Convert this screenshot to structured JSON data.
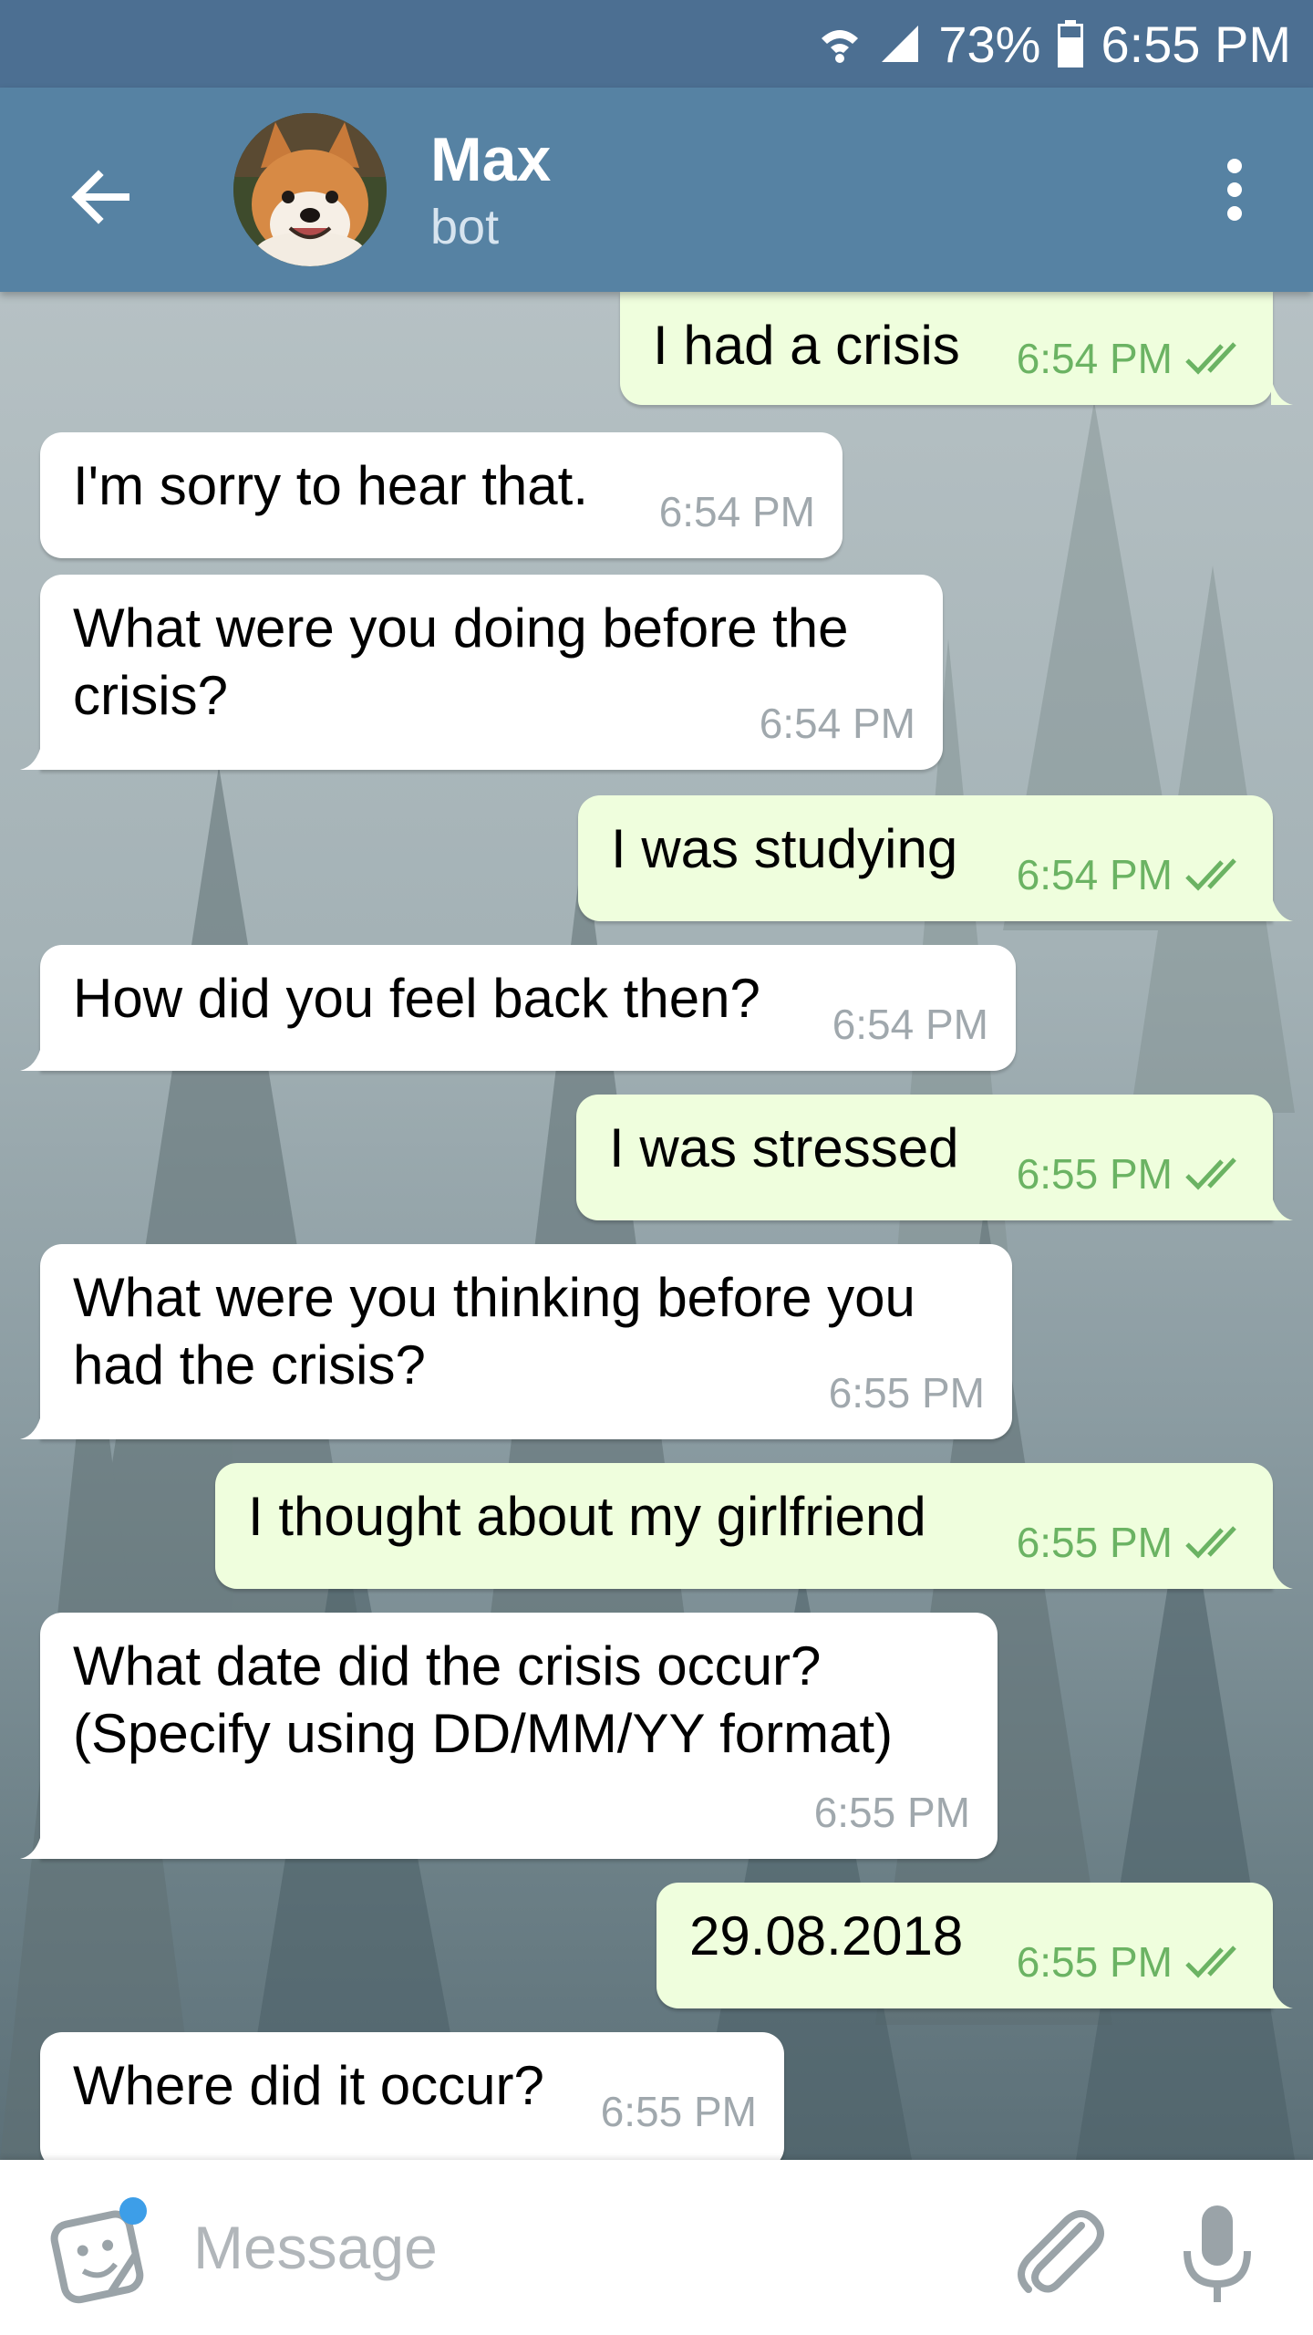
{
  "status_bar": {
    "battery": "73%",
    "time": "6:55 PM",
    "icons": [
      "wifi-icon",
      "signal-icon",
      "battery-icon"
    ]
  },
  "header": {
    "name": "Max",
    "status": "bot",
    "icons": [
      "back-arrow-icon",
      "avatar",
      "more-vert-icon"
    ]
  },
  "messages": [
    {
      "dir": "out",
      "text": "I had a crisis",
      "time": "6:54 PM"
    },
    {
      "dir": "in",
      "text": "I'm sorry to hear that.",
      "time": "6:54 PM"
    },
    {
      "dir": "in",
      "text": "What were you doing before the crisis?",
      "time": "6:54 PM"
    },
    {
      "dir": "out",
      "text": "I was studying",
      "time": "6:54 PM"
    },
    {
      "dir": "in",
      "text": "How did you feel back then?",
      "time": "6:54 PM"
    },
    {
      "dir": "out",
      "text": "I was stressed",
      "time": "6:55 PM"
    },
    {
      "dir": "in",
      "text": "What were you thinking before you had the crisis?",
      "time": "6:55 PM"
    },
    {
      "dir": "out",
      "text": "I thought about my girlfriend",
      "time": "6:55 PM"
    },
    {
      "dir": "in",
      "text": "What date did the crisis occur? (Specify using DD/MM/YY format)",
      "time": "6:55 PM"
    },
    {
      "dir": "out",
      "text": "29.08.2018",
      "time": "6:55 PM"
    },
    {
      "dir": "in",
      "text": "Where did it occur?",
      "time": "6:55 PM"
    }
  ],
  "composer": {
    "placeholder": "Message",
    "icons": [
      "sticker-icon",
      "paperclip-icon",
      "microphone-icon"
    ]
  },
  "colors": {
    "status_bar": "#4c6f92",
    "header": "#5682a3",
    "incoming_bubble": "#ffffff",
    "outgoing_bubble": "#effedd",
    "outgoing_time": "#6bb363",
    "incoming_time": "#a0a8ad",
    "badge_dot": "#3d9ee8"
  }
}
